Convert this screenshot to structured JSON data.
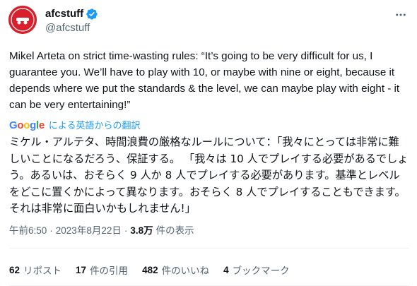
{
  "account": {
    "display_name": "afcstuff",
    "handle": "@afcstuff",
    "avatar_icon": "cannon-logo-icon",
    "verified_icon": "verified-badge-icon",
    "verified_color": "#1d9bf0",
    "brand_color": "#d8202c"
  },
  "tweet": {
    "text": "Mikel Arteta on strict time-wasting rules: “It’s going to be very difficult for us, I guarantee you. We’ll have to play with 10, or maybe with nine or eight, because it depends where we put the standards & the level, we can maybe play with eight - it can be very entertaining!”",
    "translate_label": "による英語からの翻訳",
    "translation": "ミケル・アルテタ、時間浪費の厳格なルールについて：「我々にとっては非常に難しいことになるだろう、保証する。 「我々は 10 人でプレイする必要があるでしょう。あるいは、おそらく 9 人か 8 人でプレイする必要があります。基準とレベルをどこに置くかによって異なります。おそらく 8 人でプレイすることもできます。それは非常に面白いかもしれません!」"
  },
  "meta": {
    "time": "午前6:50",
    "date": "2023年8月22日",
    "views_count": "3.8万",
    "views_label": "件の表示",
    "separator": "·"
  },
  "stats": {
    "reposts_count": "62",
    "reposts_label": "リポスト",
    "quotes_count": "17",
    "quotes_label": "件の引用",
    "likes_count": "482",
    "likes_label": "件のいいね",
    "bookmarks_count": "4",
    "bookmarks_label": "ブックマーク"
  },
  "google_logo": {
    "letters": [
      "G",
      "o",
      "o",
      "g",
      "l",
      "e"
    ],
    "colors": [
      "#4285F4",
      "#EA4335",
      "#FBBC05",
      "#4285F4",
      "#34A853",
      "#EA4335"
    ]
  }
}
